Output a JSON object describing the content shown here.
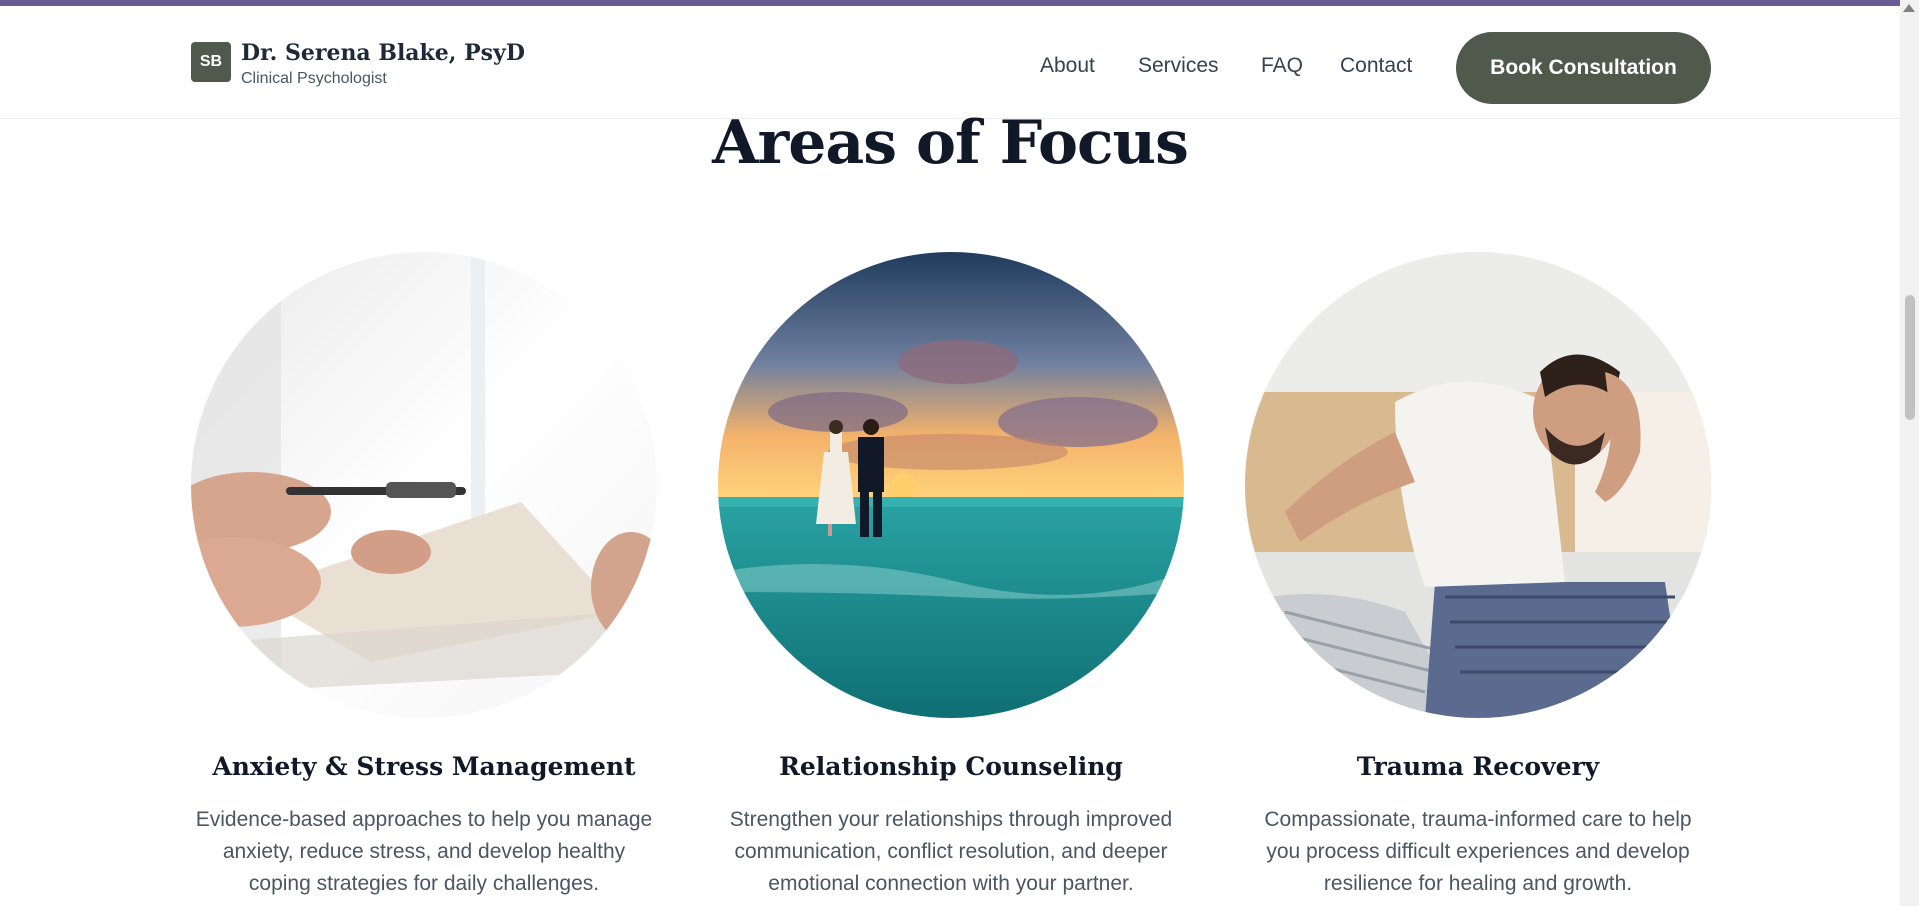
{
  "header": {
    "logo_initials": "SB",
    "brand_name": "Dr. Serena Blake, PsyD",
    "brand_subtitle": "Clinical Psychologist",
    "nav": {
      "about": "About",
      "services": "Services",
      "faq": "FAQ",
      "contact": "Contact"
    },
    "cta_label": "Book Consultation"
  },
  "section": {
    "title": "Areas of Focus",
    "cards": [
      {
        "title": "Anxiety & Stress Management",
        "description": "Evidence-based approaches to help you manage anxiety, reduce stress, and develop healthy coping strategies for daily challenges.",
        "image": "hands-document-pen-photo"
      },
      {
        "title": "Relationship Counseling",
        "description": "Strengthen your relationships through improved communication, conflict resolution, and deeper emotional connection with your partner.",
        "image": "couple-beach-sunset-photo"
      },
      {
        "title": "Trauma Recovery",
        "description": "Compassionate, trauma-informed care to help you process difficult experiences and develop resilience for healing and growth.",
        "image": "distressed-man-bed-photo"
      }
    ]
  },
  "colors": {
    "accent_bar": "#6b5b95",
    "brand_green": "#4f5a4d"
  }
}
